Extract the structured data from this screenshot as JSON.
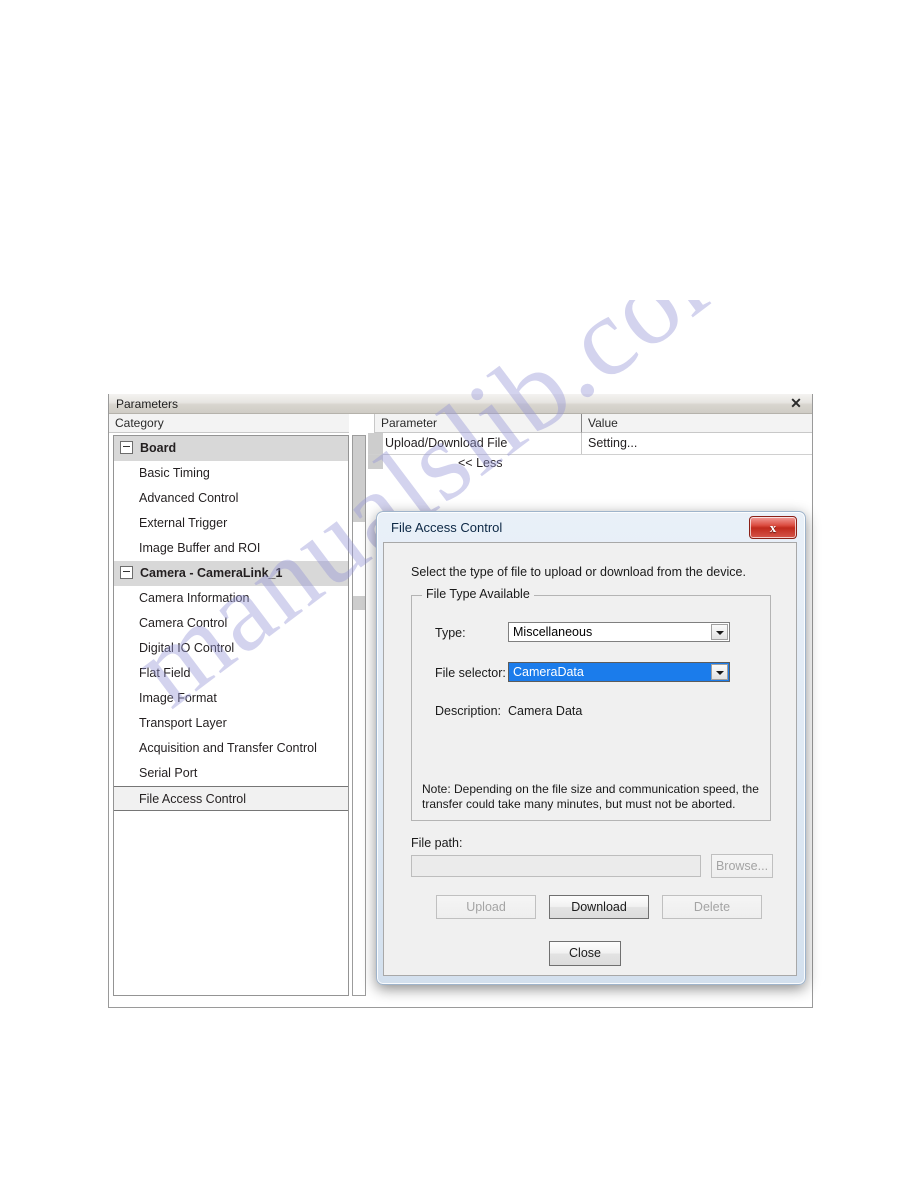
{
  "watermark": {
    "text": "manualslib.com"
  },
  "params_window": {
    "title": "Parameters",
    "close_icon": "close-icon",
    "headers": {
      "category": "Category",
      "parameter": "Parameter",
      "value": "Value"
    },
    "tree": [
      {
        "label": "Board",
        "type": "group",
        "expanded": true
      },
      {
        "label": "Basic Timing",
        "type": "leaf"
      },
      {
        "label": "Advanced Control",
        "type": "leaf"
      },
      {
        "label": "External Trigger",
        "type": "leaf"
      },
      {
        "label": "Image Buffer and ROI",
        "type": "leaf"
      },
      {
        "label": "Camera - CameraLink_1",
        "type": "group",
        "expanded": true
      },
      {
        "label": "Camera Information",
        "type": "leaf"
      },
      {
        "label": "Camera Control",
        "type": "leaf"
      },
      {
        "label": "Digital IO Control",
        "type": "leaf"
      },
      {
        "label": "Flat Field",
        "type": "leaf"
      },
      {
        "label": "Image Format",
        "type": "leaf"
      },
      {
        "label": "Transport Layer",
        "type": "leaf"
      },
      {
        "label": "Acquisition and Transfer Control",
        "type": "leaf"
      },
      {
        "label": "Serial Port",
        "type": "leaf"
      },
      {
        "label": "File Access Control",
        "type": "leaf",
        "selected": true
      }
    ],
    "rows": [
      {
        "parameter": "Upload/Download File",
        "value": "Setting..."
      }
    ],
    "less_label": "<< Less"
  },
  "dialog": {
    "title": "File Access Control",
    "close_icon": "close-icon",
    "intro": "Select the type of file to upload or download from the device.",
    "group_legend": "File Type Available",
    "type_label": "Type:",
    "type_value": "Miscellaneous",
    "file_selector_label": "File selector:",
    "file_selector_value": "CameraData",
    "description_label": "Description:",
    "description_value": "Camera Data",
    "note": "Note: Depending on the file size and communication speed, the transfer could take many minutes, but must not be aborted.",
    "filepath_label": "File path:",
    "filepath_value": "",
    "filepath_placeholder": "",
    "browse_label": "Browse...",
    "upload_label": "Upload",
    "download_label": "Download",
    "delete_label": "Delete",
    "close_label": "Close",
    "selection_color": "#1b7ceb",
    "titlebar_close_color": "#c02a1d"
  }
}
